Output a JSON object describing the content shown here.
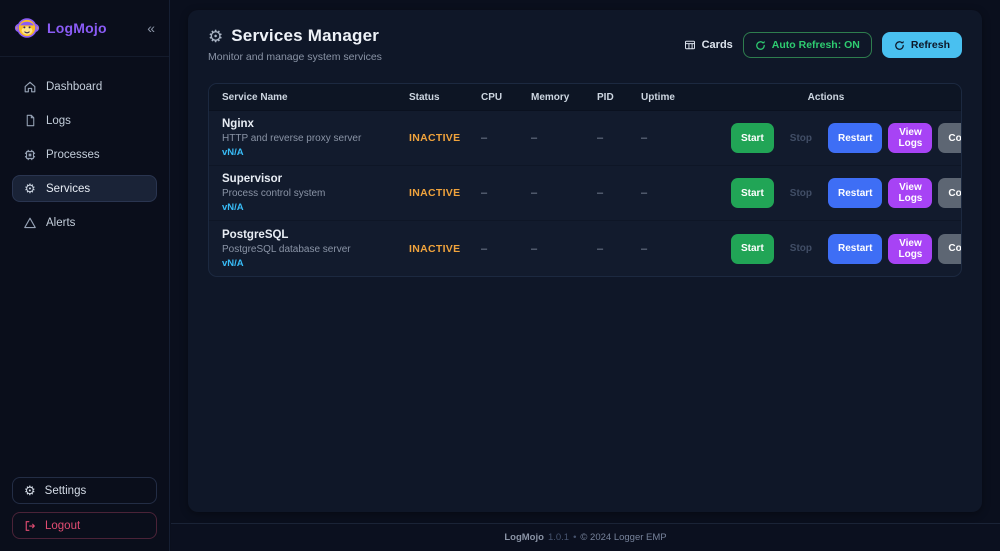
{
  "app": {
    "name": "LogMojo",
    "collapse_label": "«"
  },
  "sidebar": {
    "items": [
      {
        "label": "Dashboard",
        "icon": "home-icon",
        "active": false
      },
      {
        "label": "Logs",
        "icon": "file-icon",
        "active": false
      },
      {
        "label": "Processes",
        "icon": "chip-icon",
        "active": false
      },
      {
        "label": "Services",
        "icon": "gear-icon",
        "active": true
      },
      {
        "label": "Alerts",
        "icon": "warning-icon",
        "active": false
      }
    ],
    "settings_label": "Settings",
    "logout_label": "Logout"
  },
  "header": {
    "title": "Services Manager",
    "title_icon": "gear-icon",
    "subtitle": "Monitor and manage system services",
    "cards_label": "Cards",
    "auto_refresh_label": "Auto Refresh: ON",
    "refresh_label": "Refresh"
  },
  "table": {
    "columns": [
      "Service Name",
      "Status",
      "CPU",
      "Memory",
      "PID",
      "Uptime",
      "Actions"
    ],
    "rows": [
      {
        "name": "Nginx",
        "description": "HTTP and reverse proxy server",
        "version": "vN/A",
        "status": "INACTIVE",
        "cpu": "–",
        "memory": "–",
        "pid": "–",
        "uptime": "–"
      },
      {
        "name": "Supervisor",
        "description": "Process control system",
        "version": "vN/A",
        "status": "INACTIVE",
        "cpu": "–",
        "memory": "–",
        "pid": "–",
        "uptime": "–"
      },
      {
        "name": "PostgreSQL",
        "description": "PostgreSQL database server",
        "version": "vN/A",
        "status": "INACTIVE",
        "cpu": "–",
        "memory": "–",
        "pid": "–",
        "uptime": "–"
      }
    ],
    "actions": {
      "start": "Start",
      "stop": "Stop",
      "restart": "Restart",
      "view_logs": "View Logs",
      "config": "Config"
    }
  },
  "footer": {
    "app_name": "LogMojo",
    "version": "1.0.1",
    "separator": "•",
    "copyright": "© 2024 Logger EMP"
  },
  "colors": {
    "brand_purple": "#8b5cf6",
    "status_inactive": "#f0a33c",
    "start_green": "#21a556",
    "restart_blue": "#3e6ef5",
    "view_logs_purple": "#a743f5",
    "config_gray": "#5d6673",
    "refresh_cyan": "#49c0f0",
    "auto_refresh_green": "#2ecc71",
    "version_blue": "#38bdf8",
    "logout_red": "#e14c72",
    "background": "#0a0f1d",
    "card_background": "#0f1728"
  }
}
